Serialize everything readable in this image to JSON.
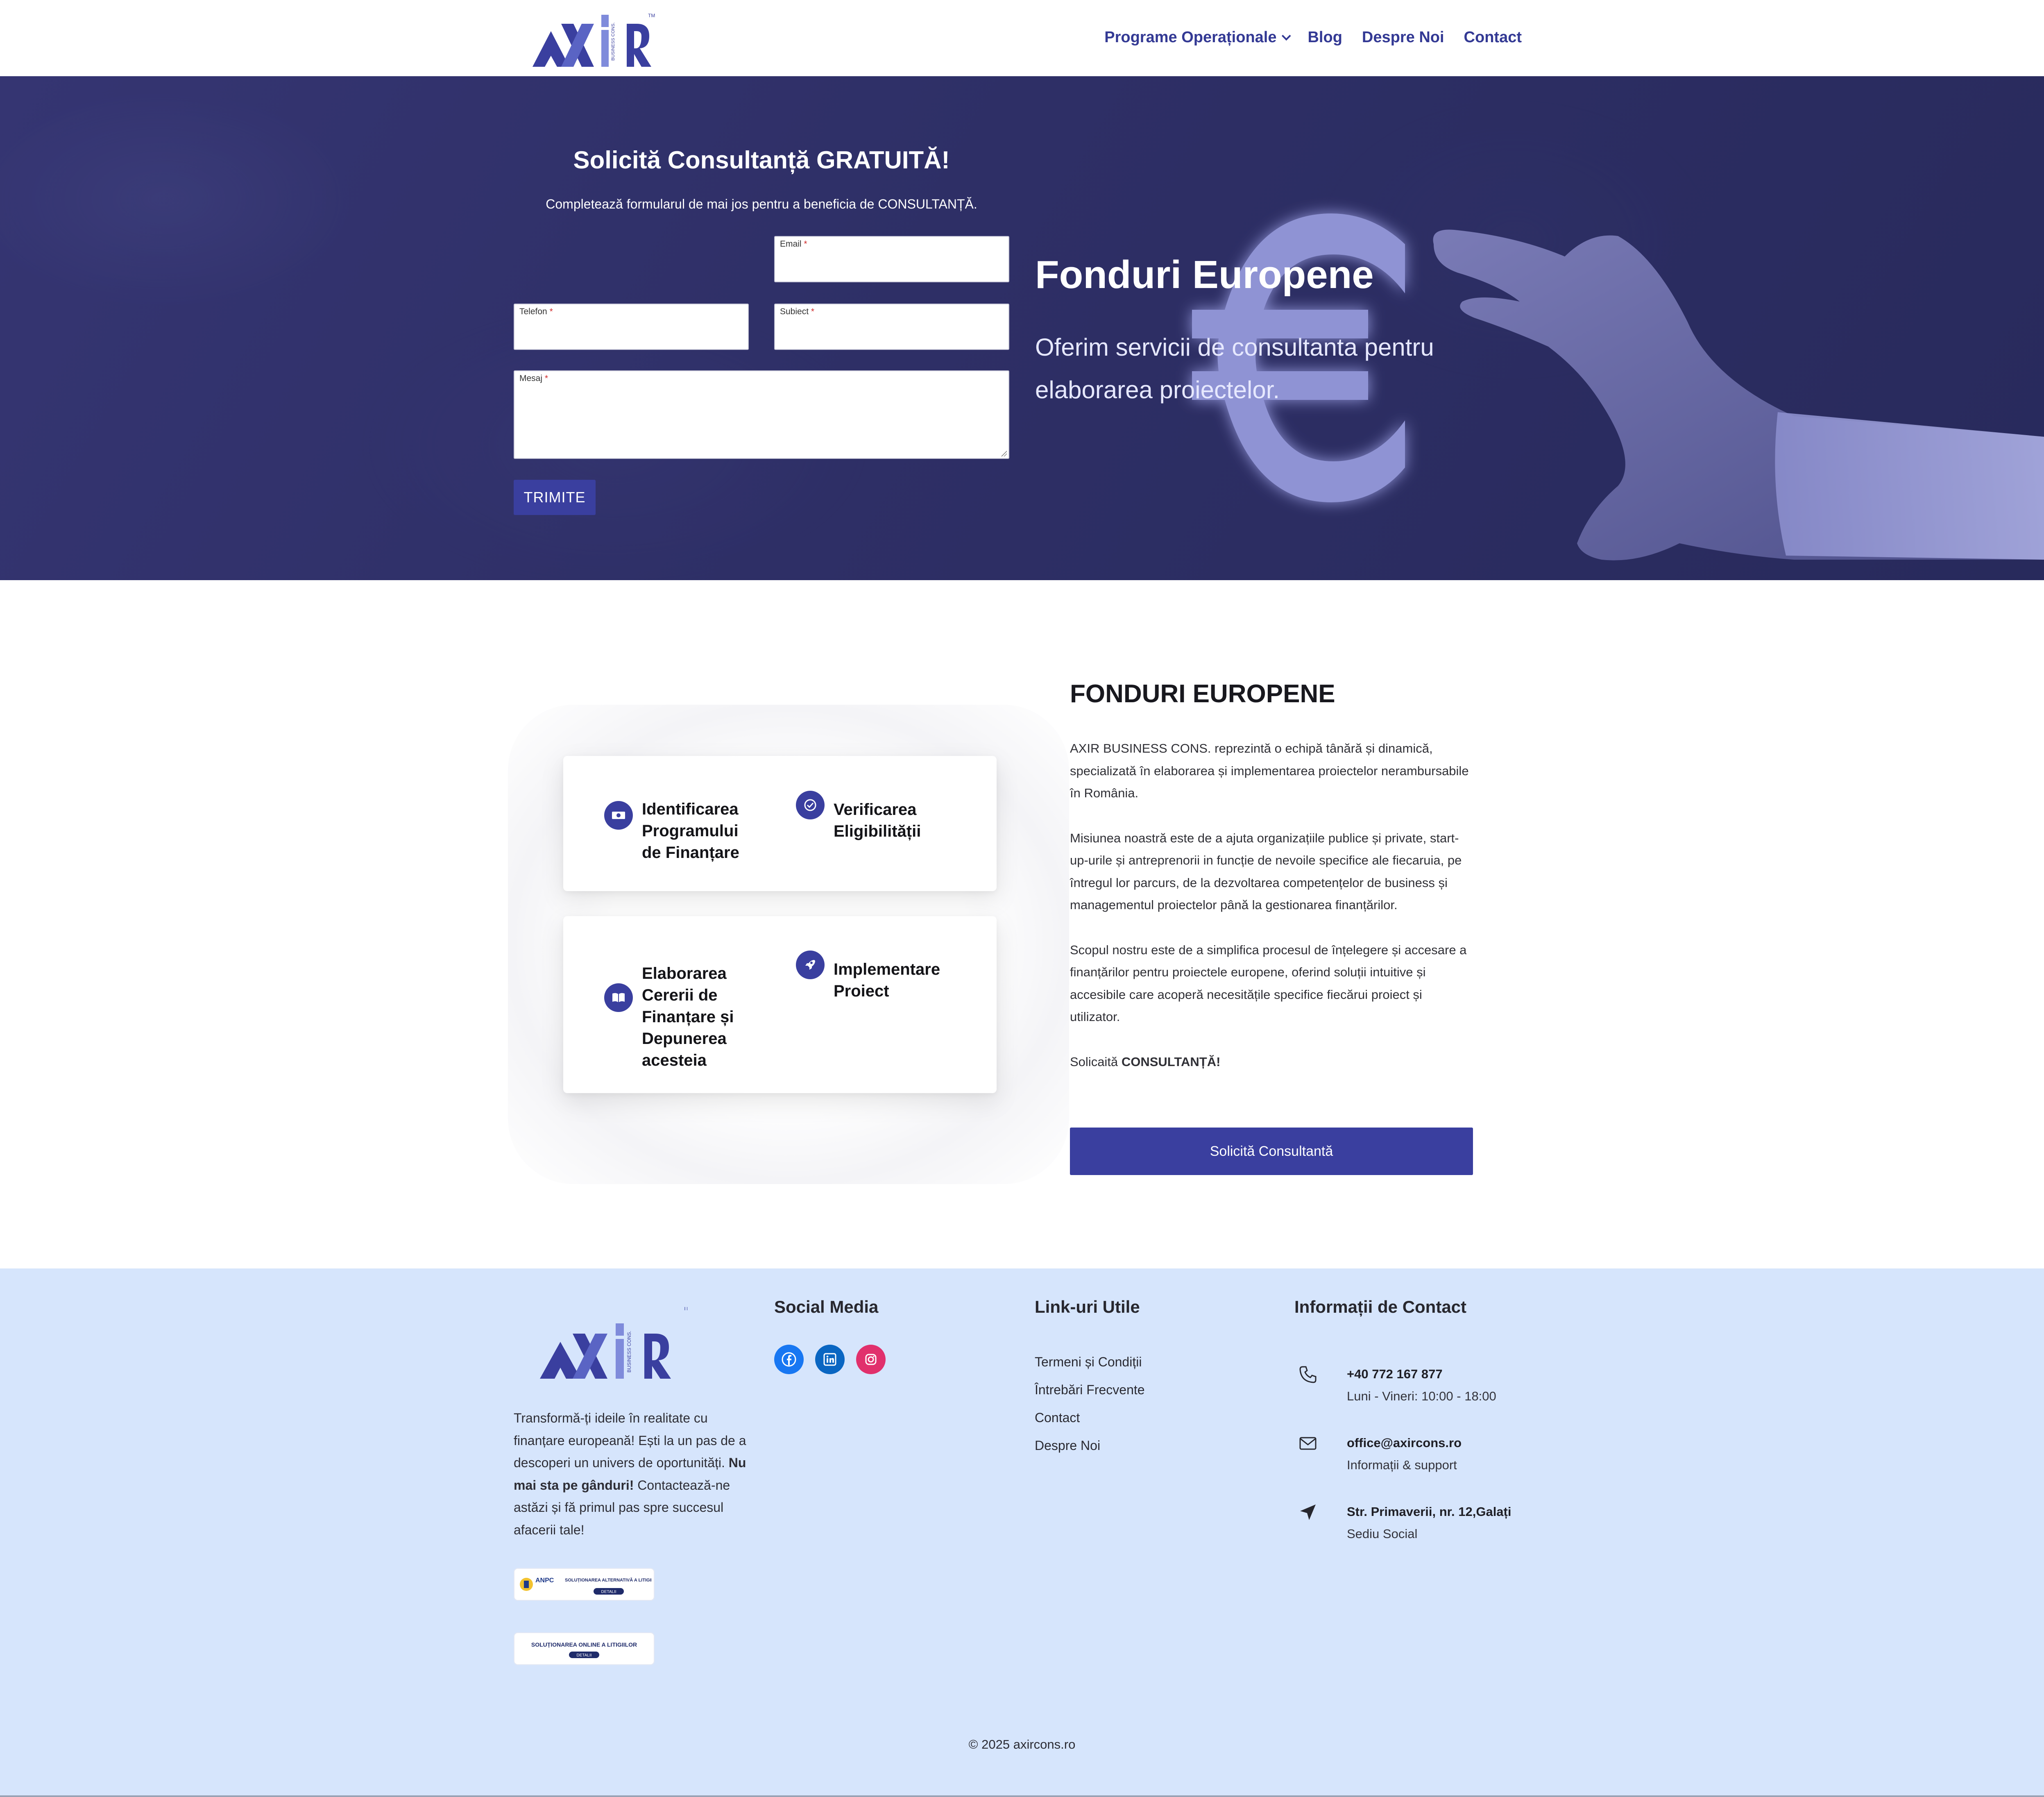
{
  "header": {
    "logo_text": "AXIR",
    "logo_sub": "BUSINESS CONS.",
    "trademark": "TM",
    "nav": [
      {
        "label": "Programe Operaționale"
      },
      {
        "label": "Blog"
      },
      {
        "label": "Despre Noi"
      },
      {
        "label": "Contact"
      }
    ]
  },
  "hero": {
    "form_title": "Solicită Consultanță GRATUITĂ!",
    "form_subtitle": "Completează formularul de mai jos pentru a beneficia de CONSULTANȚĂ.",
    "fields": {
      "email": "Email",
      "telefon": "Telefon",
      "subiect": "Subiect",
      "mesaj": "Mesaj"
    },
    "required_mark": "*",
    "submit": "TRIMITE",
    "title": "Fonduri Europene",
    "subtitle": "Oferim servicii de consultanta pentru elaborarea proiectelor."
  },
  "features": [
    {
      "label": "Identificarea Programului de Finanțare",
      "icon": "money-icon"
    },
    {
      "label": "Verificarea Eligibilității",
      "icon": "check-badge-icon"
    },
    {
      "label": "Elaborarea Cererii de Finanțare și Depunerea acesteia",
      "icon": "book-icon"
    },
    {
      "label": "Implementare Proiect",
      "icon": "rocket-icon"
    }
  ],
  "about": {
    "title": "FONDURI EUROPENE",
    "p1": "AXIR BUSINESS CONS. reprezintă o echipă tânără și dinamică, specializată în elaborarea și implementarea proiectelor nerambursabile în România.",
    "p2": "Misiunea noastră este de a ajuta organizațiile publice și private, start-up-urile și antreprenorii in funcție de nevoile specifice ale fiecaruia, pe întregul lor parcurs, de la dezvoltarea competențelor de business și managementul proiectelor până la gestionarea finanțărilor.",
    "p3": "Scopul nostru este de a simplifica procesul de înțelegere și accesare a finanțărilor pentru proiectele europene, oferind soluții intuitive și accesibile care acoperă necesitățile specifice fiecărui proiect și utilizator.",
    "cta_prefix": "Solicaită",
    "cta_bold": "CONSULTANȚĂ!",
    "button": "Solicită Consultantă"
  },
  "footer": {
    "about_text": "Transformă-ți ideile în realitate cu finanțare europeană! Ești la un pas de a descoperi un univers de oportunități.",
    "about_bold": "Nu mai sta pe gânduri!",
    "about_text2": "Contactează-ne astăzi și fă primul pas spre succesul afacerii tale!",
    "badge1_title": "ANPC",
    "badge1_text": "SOLUȚIONAREA ALTERNATIVĂ A LITIGIILOR",
    "badge1_btn": "DETALII",
    "badge2_text": "SOLUȚIONAREA ONLINE A LITIGIILOR",
    "badge2_btn": "DETALII",
    "social_title": "Social Media",
    "social": [
      "facebook-icon",
      "linkedin-icon",
      "instagram-icon"
    ],
    "links_title": "Link-uri Utile",
    "links": [
      "Termeni și Condiții",
      "Întrebări Frecvente",
      "Contact",
      "Despre Noi"
    ],
    "contact_title": "Informații de Contact",
    "contact": [
      {
        "main": "+40 772 167 877",
        "sub": "Luni - Vineri: 10:00 - 18:00",
        "icon": "phone-icon"
      },
      {
        "main": "office@axircons.ro",
        "sub": "Informații & support",
        "icon": "mail-icon"
      },
      {
        "main": "Str. Primaverii, nr. 12,Galați",
        "sub": "Sediu Social",
        "icon": "location-icon"
      }
    ],
    "copyright": "© 2025 axircons.ro"
  },
  "colors": {
    "brand": "#3a3f9f",
    "hero_bg": "#2e2f66",
    "footer_bg": "#d6e5fc",
    "facebook": "#1877f2",
    "linkedin": "#0a66c2",
    "instagram": "#e1306c"
  }
}
